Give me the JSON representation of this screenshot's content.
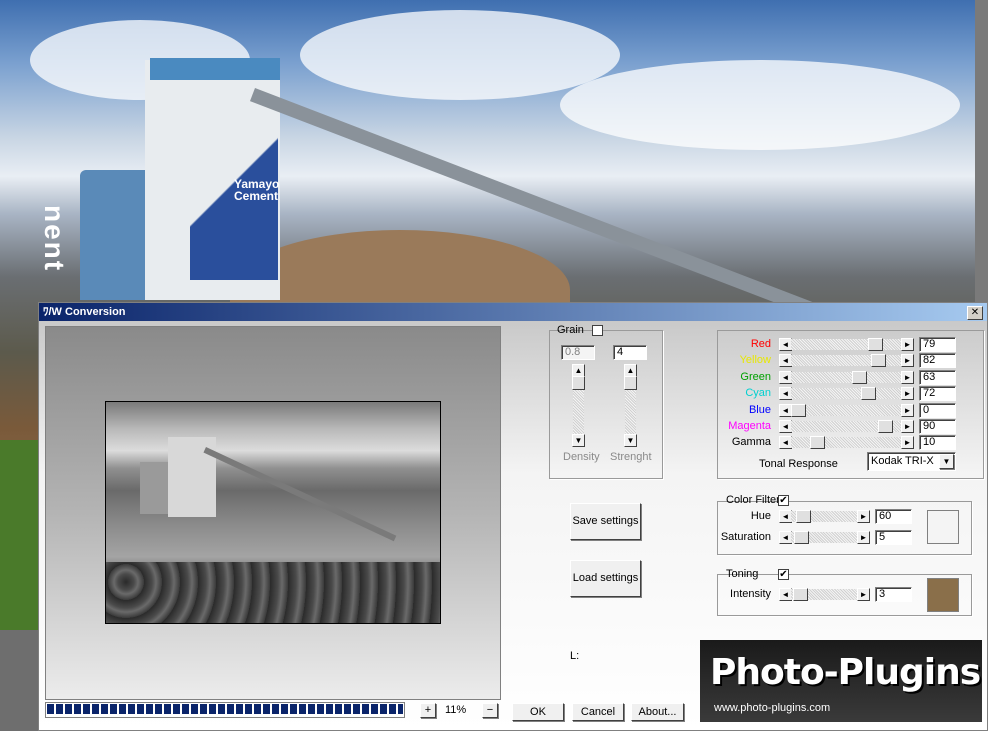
{
  "background": {
    "tower_brand_line1": "Yamayo",
    "tower_brand_line2": "Cement",
    "vertical_text": "nent"
  },
  "dialog": {
    "title": "ﾜ/W Conversion",
    "close_label": "✕"
  },
  "grain": {
    "label": "Grain",
    "enabled": false,
    "density_value": "0.8",
    "strength_value": "4",
    "density_label": "Density",
    "strength_label": "Strenght",
    "density_level": 0.0,
    "strength_level": 0.0
  },
  "channels": [
    {
      "label": "Red",
      "color": "#ff0000",
      "value": "79",
      "level": 0.79
    },
    {
      "label": "Yellow",
      "color": "#e8e800",
      "value": "82",
      "level": 0.82
    },
    {
      "label": "Green",
      "color": "#00a000",
      "value": "63",
      "level": 0.63
    },
    {
      "label": "Cyan",
      "color": "#00d0d0",
      "value": "72",
      "level": 0.72
    },
    {
      "label": "Blue",
      "color": "#0000ff",
      "value": "0",
      "level": 0.0
    },
    {
      "label": "Magenta",
      "color": "#ff00ff",
      "value": "90",
      "level": 0.9
    },
    {
      "label": "Gamma",
      "color": "#000000",
      "value": "10",
      "level": 0.2
    }
  ],
  "tonal": {
    "label": "Tonal Response",
    "selected": "Kodak TRI-X"
  },
  "color_filter": {
    "label": "Color Filter",
    "enabled": true,
    "hue_label": "Hue",
    "hue_value": "60",
    "hue_level": 0.1,
    "saturation_label": "Saturation",
    "saturation_value": "5",
    "saturation_level": 0.05,
    "swatch_color": "#f4f4f4"
  },
  "toning": {
    "label": "Toning",
    "enabled": true,
    "intensity_label": "Intensity",
    "intensity_value": "3",
    "intensity_level": 0.03,
    "swatch_color": "#8a6f4a"
  },
  "buttons": {
    "save": "Save settings",
    "load": "Load settings",
    "ok": "OK",
    "cancel": "Cancel",
    "about": "About..."
  },
  "luminance_label": "L:",
  "zoom": {
    "plus": "+",
    "minus": "−",
    "value": "11%"
  },
  "progress": 1.0,
  "logo": {
    "text": "Photo-Plugins",
    "url": "www.photo-plugins.com"
  }
}
